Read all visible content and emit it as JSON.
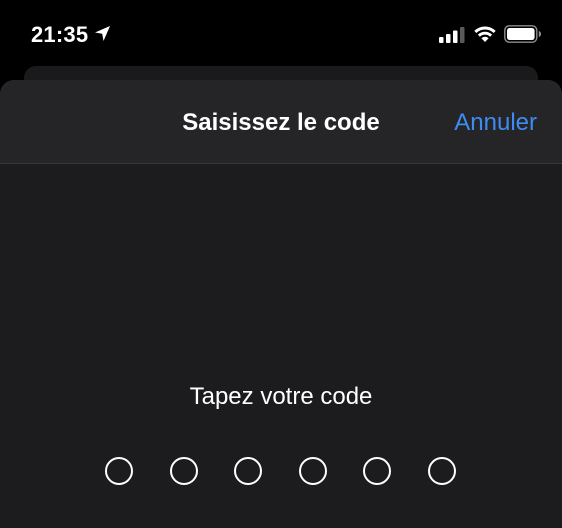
{
  "status_bar": {
    "time": "21:35",
    "icons": [
      "location-arrow-icon",
      "cellular-signal-icon",
      "wifi-icon",
      "battery-icon"
    ]
  },
  "sheet": {
    "title": "Saisissez le code",
    "cancel_label": "Annuler",
    "prompt": "Tapez votre code",
    "passcode_length": 6,
    "digits_entered": 0
  },
  "colors": {
    "background": "#000000",
    "sheet": "#1c1c1e",
    "nav_bar": "#252527",
    "accent": "#3e8bf2",
    "text": "#ffffff"
  }
}
